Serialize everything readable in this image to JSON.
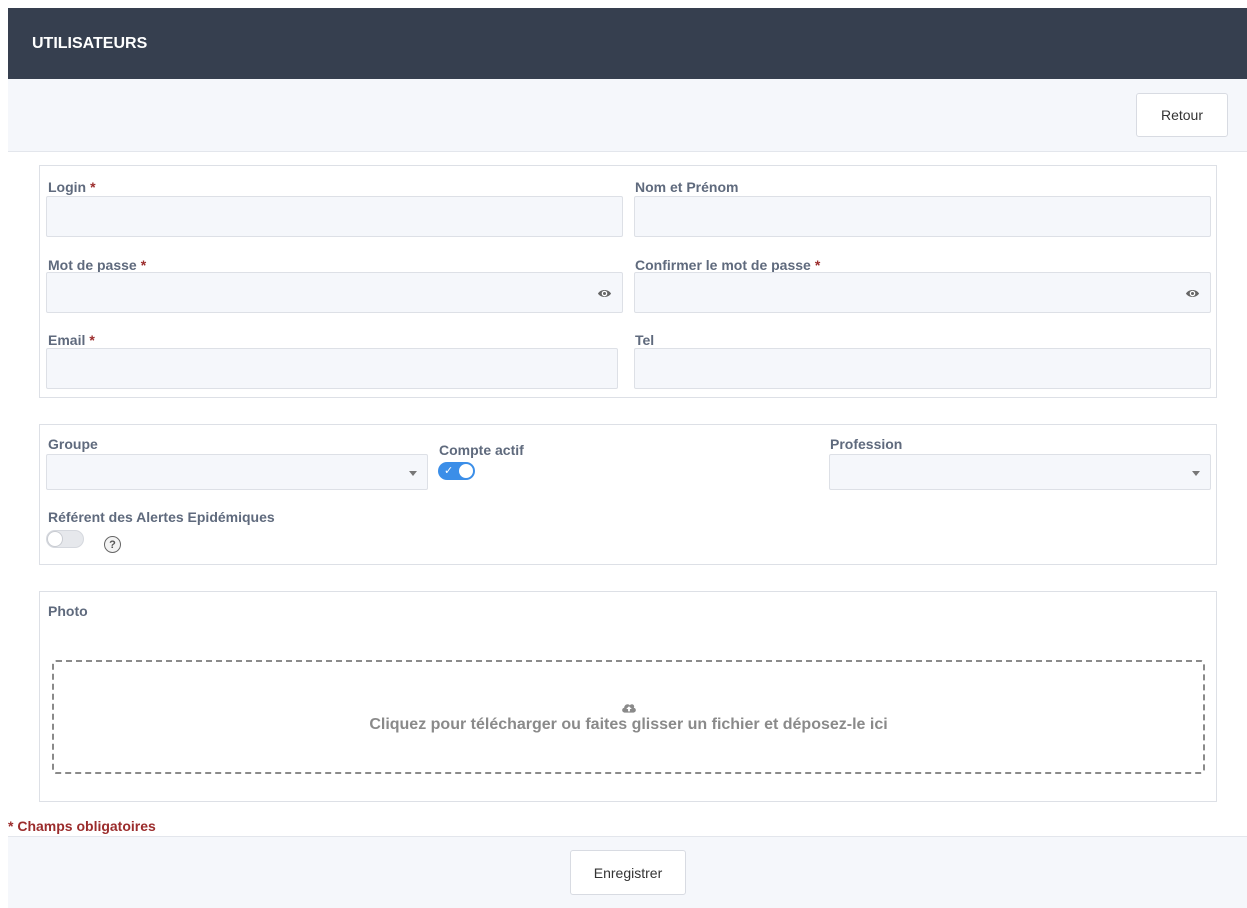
{
  "header": {
    "title": "UTILISATEURS"
  },
  "topbar": {
    "back_label": "Retour"
  },
  "required_mark": "*",
  "identity": {
    "login": {
      "label": "Login",
      "value": ""
    },
    "fullname": {
      "label": "Nom et Prénom",
      "value": ""
    },
    "password": {
      "label": "Mot de passe",
      "value": ""
    },
    "confirm_password": {
      "label": "Confirmer le mot de passe",
      "value": ""
    },
    "email": {
      "label": "Email",
      "value": ""
    },
    "tel": {
      "label": "Tel",
      "value": ""
    }
  },
  "settings": {
    "group": {
      "label": "Groupe",
      "selected": ""
    },
    "active": {
      "label": "Compte actif",
      "checked": true,
      "check_glyph": "✓"
    },
    "profession": {
      "label": "Profession",
      "selected": ""
    },
    "referent": {
      "label": "Référent des Alertes Epidémiques",
      "checked": false,
      "help_glyph": "?"
    }
  },
  "photo": {
    "label": "Photo",
    "dropzone_text": "Cliquez pour télécharger ou faites glisser un fichier et déposez-le ici",
    "icon": "cloud-upload-icon"
  },
  "footer": {
    "required_note": "* Champs obligatoires",
    "save_label": "Enregistrer"
  },
  "colors": {
    "header_bg": "#363f4f",
    "accent": "#3b8ee8",
    "required": "#9b2c2c"
  }
}
